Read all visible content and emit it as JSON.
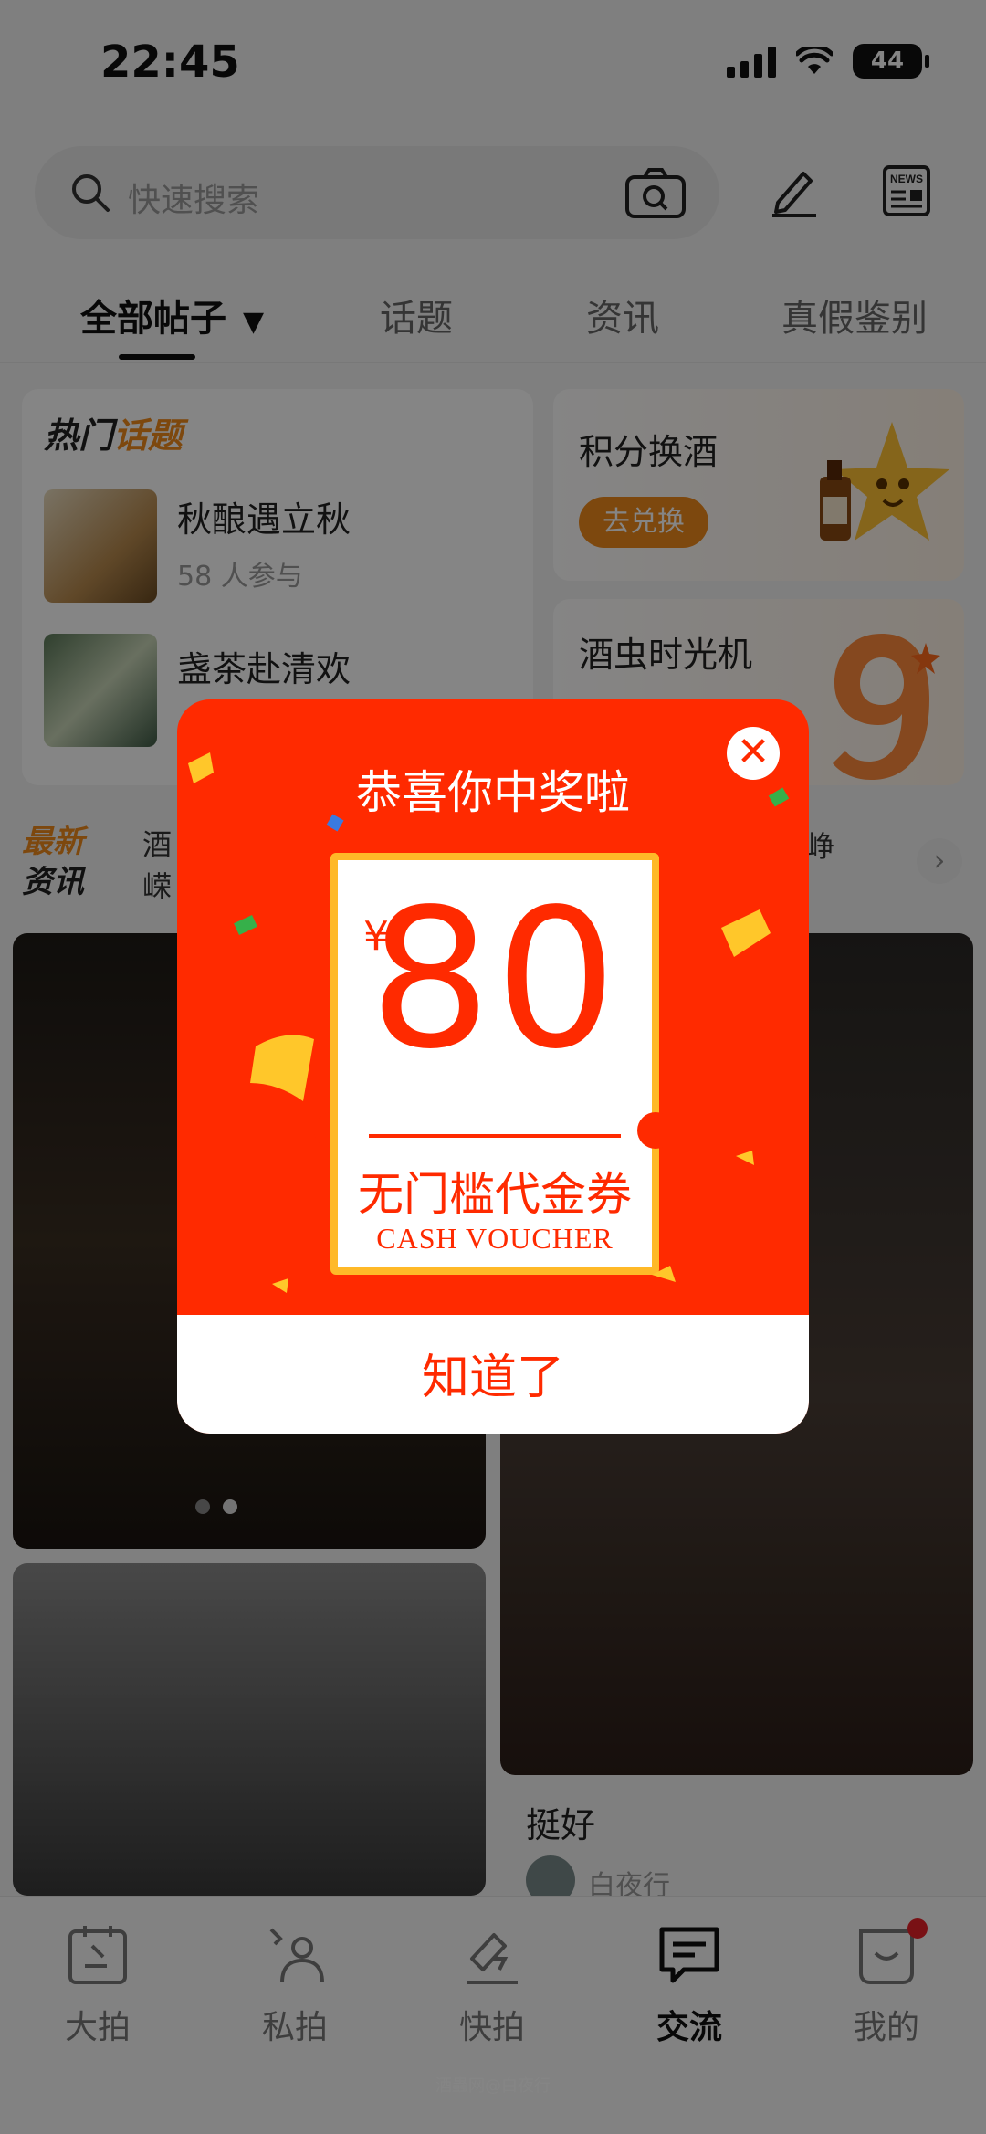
{
  "status_bar": {
    "time": "22:45",
    "battery": "44"
  },
  "header": {
    "search_placeholder": "快速搜索"
  },
  "tabs": [
    {
      "label": "全部帖子"
    },
    {
      "label": "话题"
    },
    {
      "label": "资讯"
    },
    {
      "label": "真假鉴别"
    }
  ],
  "hot_topics": {
    "title_part1": "热门",
    "title_part2": "话题",
    "items": [
      {
        "name": "秋酿遇立秋",
        "meta": "58 人参与"
      },
      {
        "name": "盏茶赴清欢",
        "meta": ""
      }
    ]
  },
  "side_cards": [
    {
      "title": "积分换酒",
      "button": "去兑换"
    },
    {
      "title": "酒虫时光机"
    }
  ],
  "news": {
    "label_part1": "最新",
    "label_part2": "资讯",
    "line1": "酒",
    "line2": "嵘",
    "line1_tail": "峥",
    "arrow": "›"
  },
  "feed": {
    "post_title": "挺好",
    "post_author": "白夜行"
  },
  "bottom_nav": [
    {
      "label": "大拍",
      "icon": "auction-icon"
    },
    {
      "label": "私拍",
      "icon": "private-icon"
    },
    {
      "label": "快拍",
      "icon": "quick-icon"
    },
    {
      "label": "交流",
      "icon": "chat-icon"
    },
    {
      "label": "我的",
      "icon": "profile-icon"
    }
  ],
  "watermark": "酒蟲网@白夜行",
  "modal": {
    "title": "恭喜你中奖啦",
    "currency": "¥",
    "amount": "80",
    "voucher_cn": "无门槛代金券",
    "voucher_en": "CASH VOUCHER",
    "confirm": "知道了",
    "close": "✕"
  },
  "colors": {
    "accent": "#ff2a00",
    "gold": "#ffb928",
    "orange": "#f08a1c"
  }
}
